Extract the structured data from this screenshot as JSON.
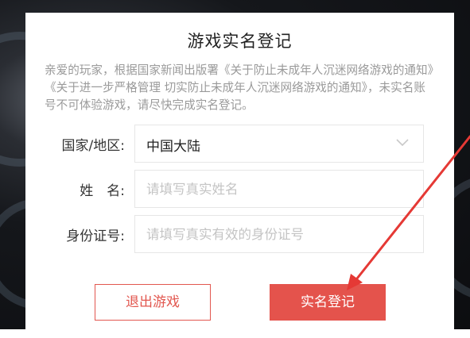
{
  "dialog": {
    "title": "游戏实名登记",
    "notice": "亲爱的玩家，根据国家新闻出版署《关于防止未成年人沉迷网络游戏的通知》《关于进一步严格管理 切实防止未成年人沉迷网络游戏的通知》，未实名账号不可体验游戏，请尽快完成实名登记。"
  },
  "form": {
    "region": {
      "label": "国家/地区:",
      "value": "中国大陆"
    },
    "name": {
      "label": "姓　名:",
      "placeholder": "请填写真实姓名"
    },
    "id_number": {
      "label": "身份证号:",
      "placeholder": "请填写真实有效的身份证号"
    }
  },
  "buttons": {
    "exit_label": "退出游戏",
    "register_label": "实名登记"
  },
  "colors": {
    "accent": "#e4534c",
    "annotation_arrow": "#e53935"
  },
  "icons": {
    "region_dropdown": "chevron-down-icon"
  }
}
